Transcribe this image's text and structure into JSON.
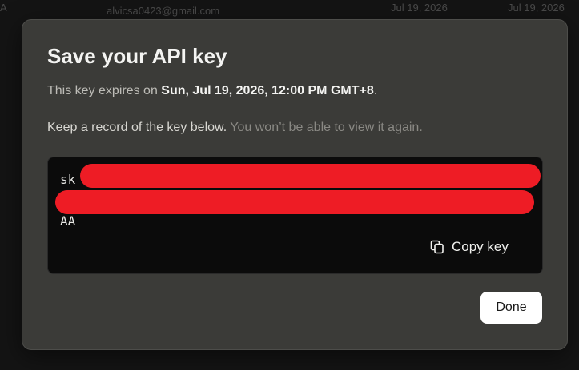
{
  "background": {
    "row_prefix": "A",
    "email": "alvicsa0423@gmail.com",
    "date_1": "Jul 19, 2026",
    "date_2": "Jul 19, 2026"
  },
  "dialog": {
    "title": "Save your API key",
    "expiry_prefix": "This key expires on ",
    "expiry_date": "Sun, Jul 19, 2026, 12:00 PM GMT+8",
    "expiry_suffix": ".",
    "record_text": "Keep a record of the key below. ",
    "record_warning": "You won’t be able to view it again.",
    "key": {
      "line_1_prefix": "sk",
      "line_3": "AA"
    },
    "copy_label": "Copy key",
    "done_label": "Done"
  },
  "colors": {
    "dialog_bg": "#3b3b38",
    "key_box_bg": "#0b0b0b",
    "redaction": "#ee1c25",
    "done_bg": "#ffffff"
  },
  "icons": {
    "copy": "copy-icon"
  }
}
